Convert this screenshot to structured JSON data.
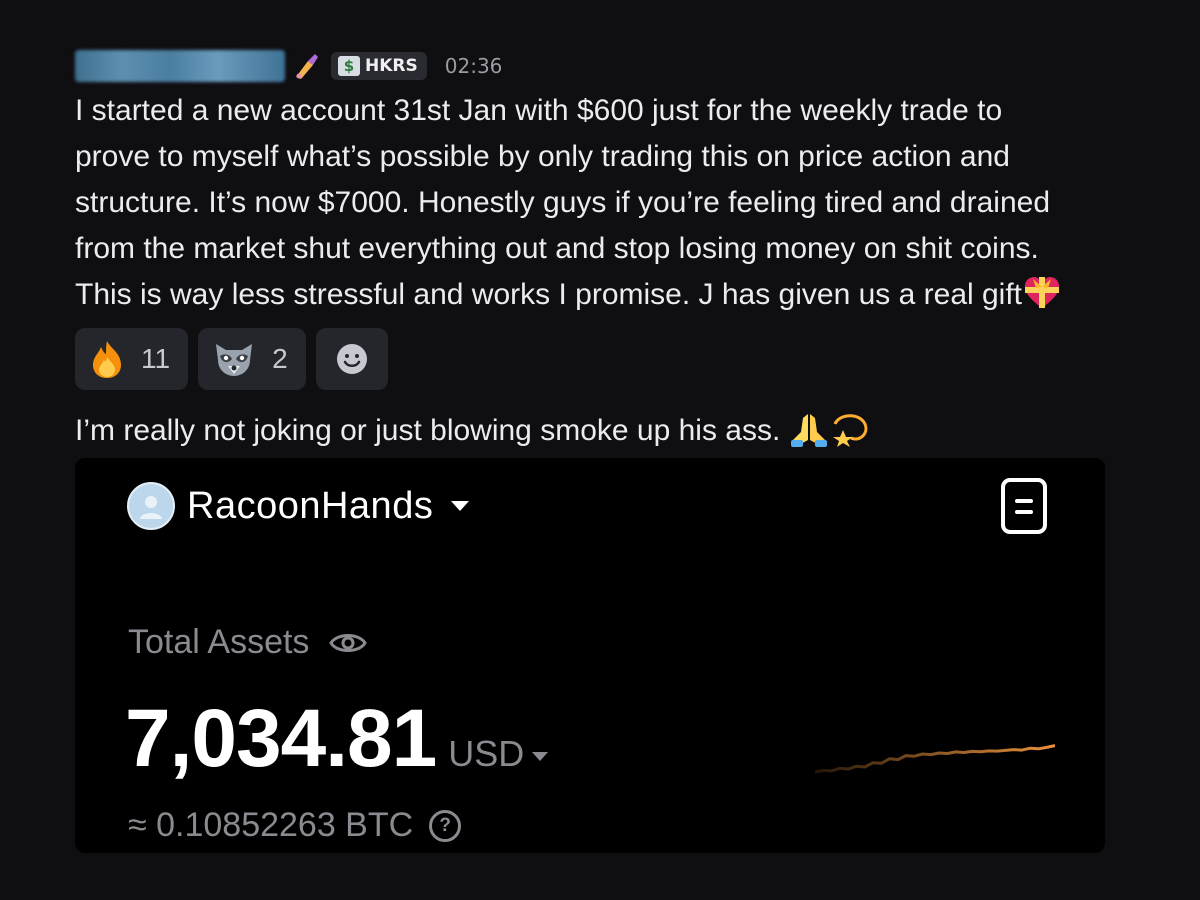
{
  "message": {
    "timestamp": "02:36",
    "role_tag": "HKRS",
    "role_tag_icon": "dollar-badge-icon",
    "username_emoji": "nail-polish-icon",
    "lines": [
      "I started a new account 31st Jan with $600 just for the weekly trade to",
      "prove to myself what’s possible by only trading this on price action and",
      "structure. It’s now $7000. Honestly guys if you’re feeling tired and drained",
      "from the market shut everything out and stop losing money on shit coins.",
      "This is way less stressful and works I promise. J has given us a real gift"
    ],
    "line_end_emoji": "heart-with-ribbon-icon"
  },
  "reactions": [
    {
      "emoji": "fire-icon",
      "count": "11"
    },
    {
      "emoji": "raccoon-icon",
      "count": "2"
    },
    {
      "emoji": "add-reaction-icon",
      "count": ""
    }
  ],
  "followup": {
    "text": "I’m really not joking or just blowing smoke up his ass.",
    "emojis": [
      "folded-hands-icon",
      "dizzy-star-icon"
    ]
  },
  "attachment": {
    "account_name": "RacoonHands",
    "total_assets_label": "Total Assets",
    "amount": "7,034.81",
    "currency": "USD",
    "btc_equivalent": "≈ 0.10852263 BTC",
    "help_glyph": "?",
    "accent_color": "#e8913c",
    "sparkline_values": [
      0.0,
      0.06,
      0.04,
      0.14,
      0.11,
      0.22,
      0.19,
      0.35,
      0.33,
      0.5,
      0.47,
      0.62,
      0.6,
      0.68,
      0.66,
      0.72,
      0.7,
      0.76,
      0.74,
      0.78,
      0.77,
      0.8,
      0.79,
      0.82,
      0.85,
      0.83,
      0.9,
      0.88,
      0.93,
      1.0
    ]
  }
}
